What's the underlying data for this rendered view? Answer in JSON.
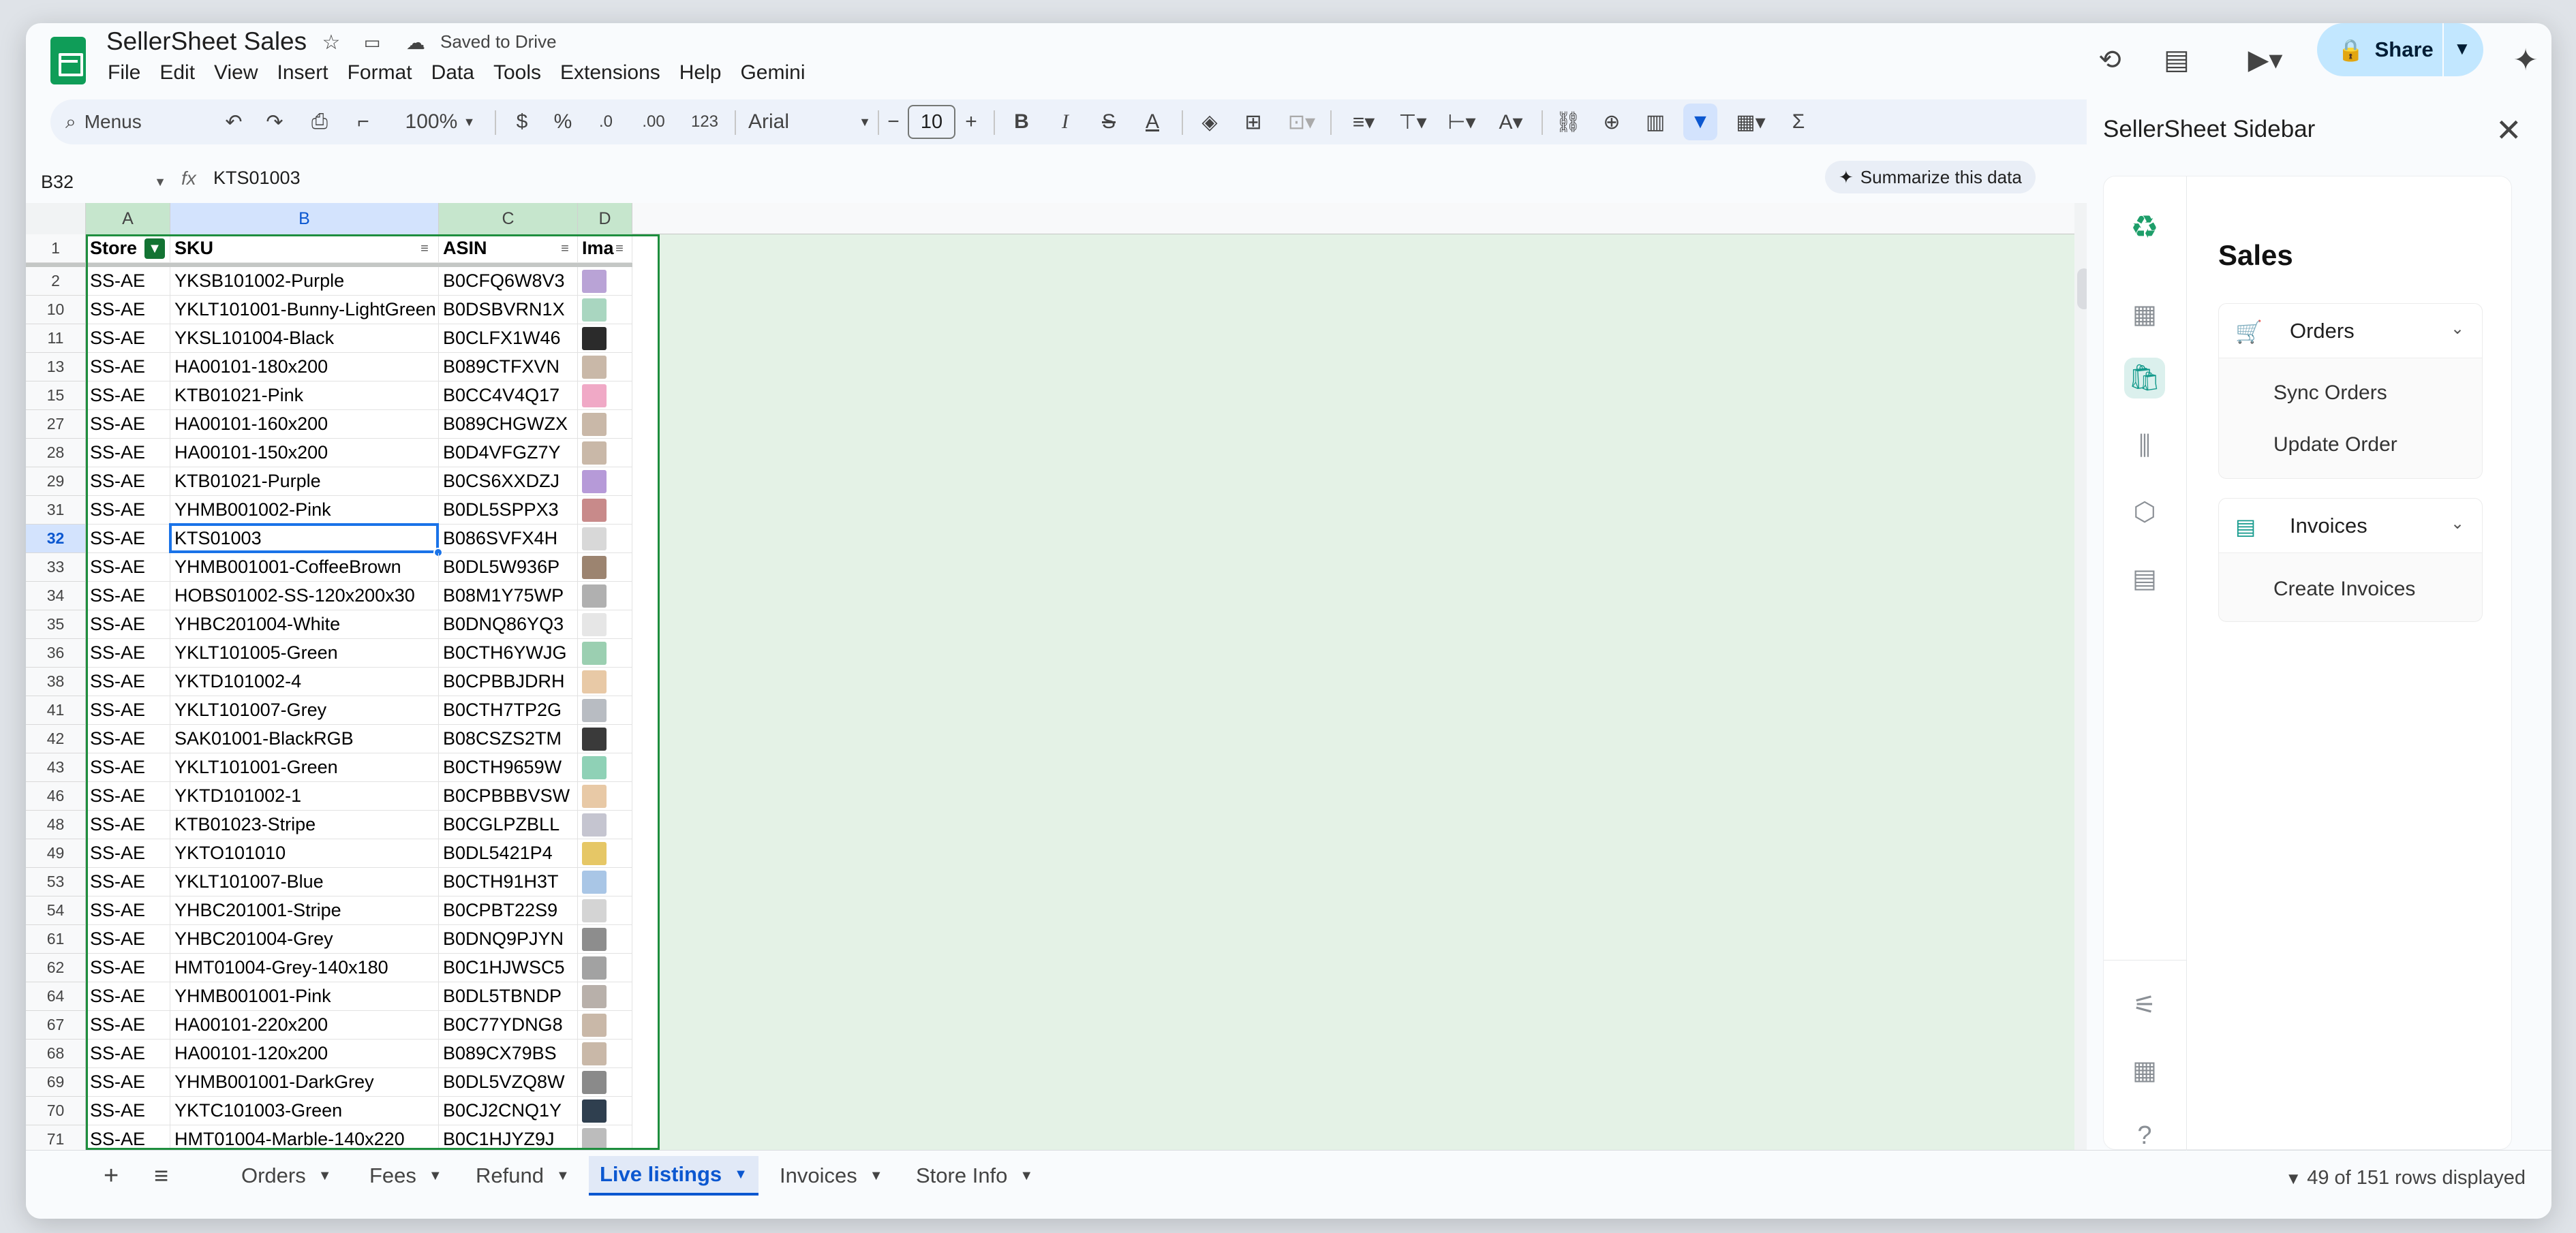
{
  "app": {
    "doc_title": "SellerSheet Sales",
    "saved_status": "Saved to Drive",
    "menus": [
      "File",
      "Edit",
      "View",
      "Insert",
      "Format",
      "Data",
      "Tools",
      "Extensions",
      "Help",
      "Gemini"
    ],
    "share_label": "Share"
  },
  "toolbar": {
    "search_menus": "Menus",
    "zoom": "100%",
    "currency": "$",
    "percent": "%",
    "dec_less": ".0",
    "dec_more": ".00",
    "number_format": "123",
    "font": "Arial",
    "font_size": "10"
  },
  "formula_bar": {
    "name_box": "B32",
    "fx": "fx",
    "value": "KTS01003",
    "summarize": "Summarize this data"
  },
  "grid": {
    "columns": [
      "A",
      "B",
      "C",
      "D"
    ],
    "header_row_number": "1",
    "headers": [
      "Store",
      "SKU",
      "ASIN",
      "Ima"
    ],
    "selected_row": "32",
    "rows": [
      {
        "n": "2",
        "store": "SS-AE",
        "sku": "YKSB101002-Purple",
        "asin": "B0CFQ6W8V3",
        "thumb": "#b9a3d6"
      },
      {
        "n": "10",
        "store": "SS-AE",
        "sku": "YKLT101001-Bunny-LightGreen",
        "asin": "B0DSBVRN1X",
        "thumb": "#a9d6c0"
      },
      {
        "n": "11",
        "store": "SS-AE",
        "sku": "YKSL101004-Black",
        "asin": "B0CLFX1W46",
        "thumb": "#2b2b2b"
      },
      {
        "n": "13",
        "store": "SS-AE",
        "sku": "HA00101-180x200",
        "asin": "B089CTFXVN",
        "thumb": "#c9b8a8"
      },
      {
        "n": "15",
        "store": "SS-AE",
        "sku": "KTB01021-Pink",
        "asin": "B0CC4V4Q17",
        "thumb": "#f0a9c6"
      },
      {
        "n": "27",
        "store": "SS-AE",
        "sku": "HA00101-160x200",
        "asin": "B089CHGWZX",
        "thumb": "#c9b8a8"
      },
      {
        "n": "28",
        "store": "SS-AE",
        "sku": "HA00101-150x200",
        "asin": "B0D4VFGZ7Y",
        "thumb": "#c9b8a8"
      },
      {
        "n": "29",
        "store": "SS-AE",
        "sku": "KTB01021-Purple",
        "asin": "B0CS6XXDZJ",
        "thumb": "#b69ad8"
      },
      {
        "n": "31",
        "store": "SS-AE",
        "sku": "YHMB001002-Pink",
        "asin": "B0DL5SPPX3",
        "thumb": "#c88a8a"
      },
      {
        "n": "32",
        "store": "SS-AE",
        "sku": "KTS01003",
        "asin": "B086SVFX4H",
        "thumb": "#d8d8d8"
      },
      {
        "n": "33",
        "store": "SS-AE",
        "sku": "YHMB001001-CoffeeBrown",
        "asin": "B0DL5W936P",
        "thumb": "#9c8470"
      },
      {
        "n": "34",
        "store": "SS-AE",
        "sku": "HOBS01002-SS-120x200x30",
        "asin": "B08M1Y75WP",
        "thumb": "#b0b0b0"
      },
      {
        "n": "35",
        "store": "SS-AE",
        "sku": "YHBC201004-White",
        "asin": "B0DNQ86YQ3",
        "thumb": "#e6e6e6"
      },
      {
        "n": "36",
        "store": "SS-AE",
        "sku": "YKLT101005-Green",
        "asin": "B0CTH6YWJG",
        "thumb": "#9bcfb1"
      },
      {
        "n": "38",
        "store": "SS-AE",
        "sku": "YKTD101002-4",
        "asin": "B0CPBBJDRH",
        "thumb": "#e8c9a6"
      },
      {
        "n": "41",
        "store": "SS-AE",
        "sku": "YKLT101007-Grey",
        "asin": "B0CTH7TP2G",
        "thumb": "#b8bcc2"
      },
      {
        "n": "42",
        "store": "SS-AE",
        "sku": "SAK01001-BlackRGB",
        "asin": "B08CSZS2TM",
        "thumb": "#3a3a3a"
      },
      {
        "n": "43",
        "store": "SS-AE",
        "sku": "YKLT101001-Green",
        "asin": "B0CTH9659W",
        "thumb": "#8fd1b6"
      },
      {
        "n": "46",
        "store": "SS-AE",
        "sku": "YKTD101002-1",
        "asin": "B0CPBBBVSW",
        "thumb": "#e8c9a6"
      },
      {
        "n": "48",
        "store": "SS-AE",
        "sku": "KTB01023-Stripe",
        "asin": "B0CGLPZBLL",
        "thumb": "#c5c5d0"
      },
      {
        "n": "49",
        "store": "SS-AE",
        "sku": "YKTO101010",
        "asin": "B0DL5421P4",
        "thumb": "#e6c766"
      },
      {
        "n": "53",
        "store": "SS-AE",
        "sku": "YKLT101007-Blue",
        "asin": "B0CTH91H3T",
        "thumb": "#a9c6e6"
      },
      {
        "n": "54",
        "store": "SS-AE",
        "sku": "YHBC201001-Stripe",
        "asin": "B0CPBT22S9",
        "thumb": "#d4d4d4"
      },
      {
        "n": "61",
        "store": "SS-AE",
        "sku": "YHBC201004-Grey",
        "asin": "B0DNQ9PJYN",
        "thumb": "#8d8d8d"
      },
      {
        "n": "62",
        "store": "SS-AE",
        "sku": "HMT01004-Grey-140x180",
        "asin": "B0C1HJWSC5",
        "thumb": "#a2a2a2"
      },
      {
        "n": "64",
        "store": "SS-AE",
        "sku": "YHMB001001-Pink",
        "asin": "B0DL5TBNDP",
        "thumb": "#b8b0aa"
      },
      {
        "n": "67",
        "store": "SS-AE",
        "sku": "HA00101-220x200",
        "asin": "B0C77YDNG8",
        "thumb": "#c9b8a8"
      },
      {
        "n": "68",
        "store": "SS-AE",
        "sku": "HA00101-120x200",
        "asin": "B089CX79BS",
        "thumb": "#c9b8a8"
      },
      {
        "n": "69",
        "store": "SS-AE",
        "sku": "YHMB001001-DarkGrey",
        "asin": "B0DL5VZQ8W",
        "thumb": "#8a8a8a"
      },
      {
        "n": "70",
        "store": "SS-AE",
        "sku": "YKTC101003-Green",
        "asin": "B0CJ2CNQ1Y",
        "thumb": "#2f3f4f"
      },
      {
        "n": "71",
        "store": "SS-AE",
        "sku": "HMT01004-Marble-140x220",
        "asin": "B0C1HJYZ9J",
        "thumb": "#bcbcbc"
      }
    ]
  },
  "tabs": {
    "items": [
      {
        "label": "Orders",
        "active": false
      },
      {
        "label": "Fees",
        "active": false
      },
      {
        "label": "Refund",
        "active": false
      },
      {
        "label": "Live listings",
        "active": true
      },
      {
        "label": "Invoices",
        "active": false
      },
      {
        "label": "Store Info",
        "active": false
      }
    ],
    "rows_displayed": "49 of 151 rows displayed"
  },
  "sidebar": {
    "title": "SellerSheet Sidebar",
    "heading": "Sales",
    "orders_label": "Orders",
    "orders_items": [
      "Sync Orders",
      "Update Order"
    ],
    "invoices_label": "Invoices",
    "invoices_items": [
      "Create Invoices"
    ]
  },
  "colors": {
    "accent": "#0b57d0",
    "share_bg": "#c2e7ff",
    "filter_green": "#137333",
    "sidebar_teal": "#159a8c"
  }
}
